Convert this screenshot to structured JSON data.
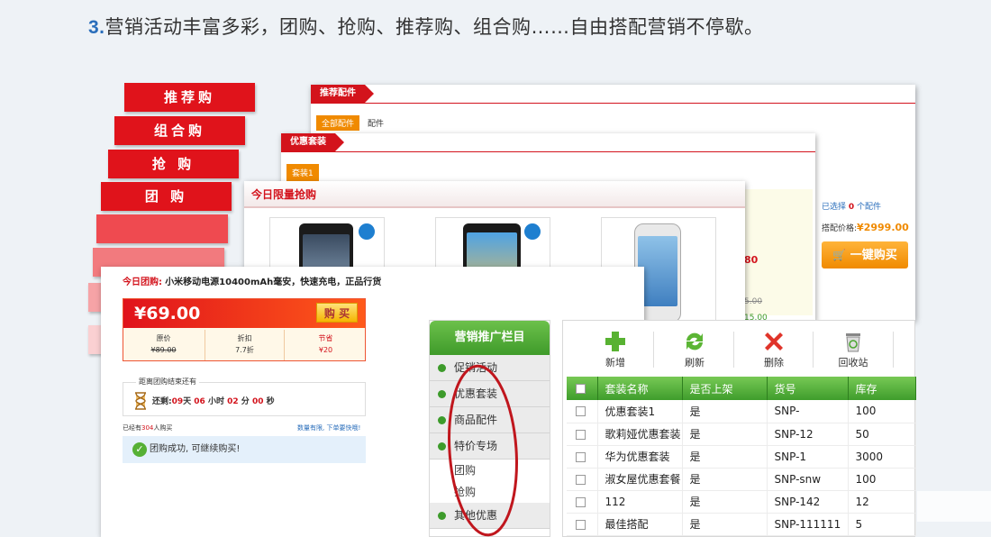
{
  "headline": {
    "num": "3.",
    "text": "营销活动丰富多彩，团购、抢购、推荐购、组合购……自由搭配营销不停歇。"
  },
  "ribbons": [
    "推荐购",
    "组合购",
    "抢 购",
    "团 购"
  ],
  "colors": {
    "accent_red": "#d3131c",
    "green": "#3f9b2a",
    "orange": "#f08a00"
  },
  "rec_panel": {
    "tab": "推荐配件",
    "filter_all": "全部配件",
    "filter_parts": "配件",
    "selected_prefix": "已选择",
    "selected_count": "0",
    "selected_suffix": "个配件",
    "price_label": "搭配价格:",
    "price_value": "¥2999.00",
    "buy_all": "一键购买"
  },
  "combo_panel": {
    "tab": "优惠套装",
    "chip": "套装1",
    "frag_a": "80",
    "frag_b": "5.00",
    "frag_c": "15.00"
  },
  "flash_panel": {
    "title": "今日限量抢购"
  },
  "group_panel": {
    "title_label": "今日团购:",
    "title_text": "小米移动电源10400mAh毫安，快速充电，正品行货",
    "price": "¥69.00",
    "buy": "购 买",
    "cols": [
      {
        "label": "原价",
        "value": "¥89.00"
      },
      {
        "label": "折扣",
        "value": "7.7折"
      },
      {
        "label": "节省",
        "value": "¥20"
      }
    ],
    "countdown_label": "距离团购结束还有",
    "remain": "还剩:",
    "days": "09",
    "days_unit": "天",
    "hours": "06",
    "hours_unit": "小时",
    "minutes": "02",
    "minutes_unit": "分",
    "seconds": "00",
    "seconds_unit": "秒",
    "bought_prefix": "已经有",
    "bought_count": "304",
    "bought_suffix": "人购买",
    "limited_note": "数量有限, 下单要快哦!",
    "success": "团购成功, 可继续购买!"
  },
  "sidebar": {
    "title": "营销推广栏目",
    "items": [
      "促销活动",
      "优惠套装",
      "商品配件",
      "特价专场"
    ],
    "subitems": [
      "团购",
      "抢购"
    ],
    "last": "其他优惠"
  },
  "toolbar": {
    "add": "新增",
    "refresh": "刷新",
    "delete": "删除",
    "recycle": "回收站"
  },
  "table": {
    "headers": [
      "套装名称",
      "是否上架",
      "货号",
      "库存"
    ],
    "rows": [
      [
        "优惠套装1",
        "是",
        "SNP-",
        "100"
      ],
      [
        "歌莉娅优惠套装",
        "是",
        "SNP-12",
        "50"
      ],
      [
        "华为优惠套装",
        "是",
        "SNP-1",
        "3000"
      ],
      [
        "淑女屋优惠套餐",
        "是",
        "SNP-snw",
        "100"
      ],
      [
        "112",
        "是",
        "SNP-142",
        "12"
      ],
      [
        "最佳搭配",
        "是",
        "SNP-111111",
        "5"
      ]
    ]
  }
}
